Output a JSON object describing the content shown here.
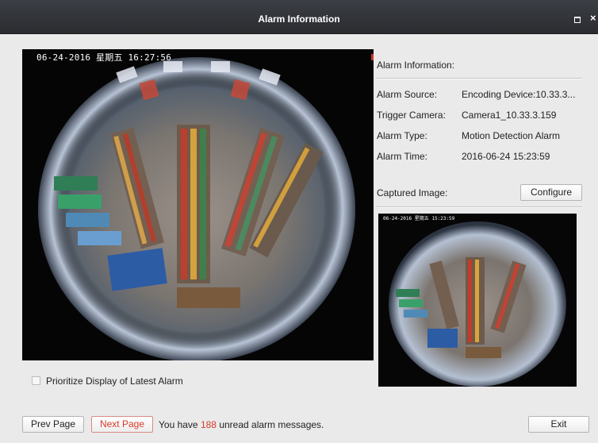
{
  "window": {
    "title": "Alarm Information"
  },
  "main_view": {
    "osd": "06-24-2016 星期五 16:27:56"
  },
  "info": {
    "heading": "Alarm Information:",
    "rows": [
      {
        "label": "Alarm Source:",
        "value": "Encoding Device:10.33.3..."
      },
      {
        "label": "Trigger Camera:",
        "value": "Camera1_10.33.3.159"
      },
      {
        "label": "Alarm Type:",
        "value": "Motion Detection Alarm"
      },
      {
        "label": "Alarm Time:",
        "value": "2016-06-24 15:23:59"
      }
    ]
  },
  "captured": {
    "label": "Captured Image:",
    "configure_label": "Configure",
    "osd": "06-24-2016 星期五 15:23:59"
  },
  "options": {
    "prioritize_label": "Prioritize Display of Latest Alarm",
    "prioritize_checked": false
  },
  "footer": {
    "prev_label": "Prev Page",
    "next_label": "Next Page",
    "status_prefix": "You have",
    "unread_count": "188",
    "status_suffix": "unread alarm messages.",
    "exit_label": "Exit"
  },
  "colors": {
    "accent_red": "#d83a2c",
    "titlebar": "#2f3236"
  }
}
